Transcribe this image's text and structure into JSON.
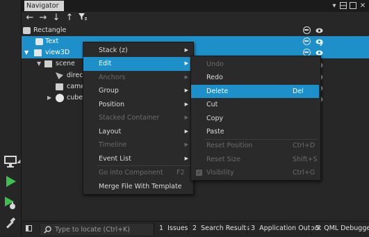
{
  "navigator": {
    "tab_label": "Navigator"
  },
  "tree": [
    {
      "label": "Rectangle"
    },
    {
      "label": "Text"
    },
    {
      "label": "view3D"
    },
    {
      "label": "scene"
    },
    {
      "label": "directi"
    },
    {
      "label": "camer"
    },
    {
      "label": "cubeM"
    }
  ],
  "context_menu": {
    "items": [
      {
        "label": "Stack (z)"
      },
      {
        "label": "Edit"
      },
      {
        "label": "Anchors"
      },
      {
        "label": "Group"
      },
      {
        "label": "Position"
      },
      {
        "label": "Stacked Container"
      },
      {
        "label": "Layout"
      },
      {
        "label": "Timeline"
      },
      {
        "label": "Event List"
      },
      {
        "label": "Go into Component",
        "shortcut": "F2"
      },
      {
        "label": "Merge File With Template"
      }
    ]
  },
  "edit_submenu": {
    "items": [
      {
        "label": "Undo"
      },
      {
        "label": "Redo"
      },
      {
        "label": "Delete",
        "shortcut": "Del"
      },
      {
        "label": "Cut"
      },
      {
        "label": "Copy"
      },
      {
        "label": "Paste"
      },
      {
        "label": "Reset Position",
        "shortcut": "Ctrl+D"
      },
      {
        "label": "Reset Size",
        "shortcut": "Shift+S"
      },
      {
        "label": "Visibility",
        "shortcut": "Ctrl+G"
      }
    ]
  },
  "statusbar": {
    "locate_placeholder": "Type to locate (Ctrl+K)",
    "panes": [
      {
        "num": "1",
        "label": "Issues"
      },
      {
        "num": "2",
        "label": "Search Results"
      },
      {
        "num": "3",
        "label": "Application Output"
      },
      {
        "num": "5",
        "label": "QML Debugger Co"
      }
    ]
  },
  "colors": {
    "selection": "#1d90c9",
    "background": "#272727",
    "run_green": "#3fbf4f"
  }
}
